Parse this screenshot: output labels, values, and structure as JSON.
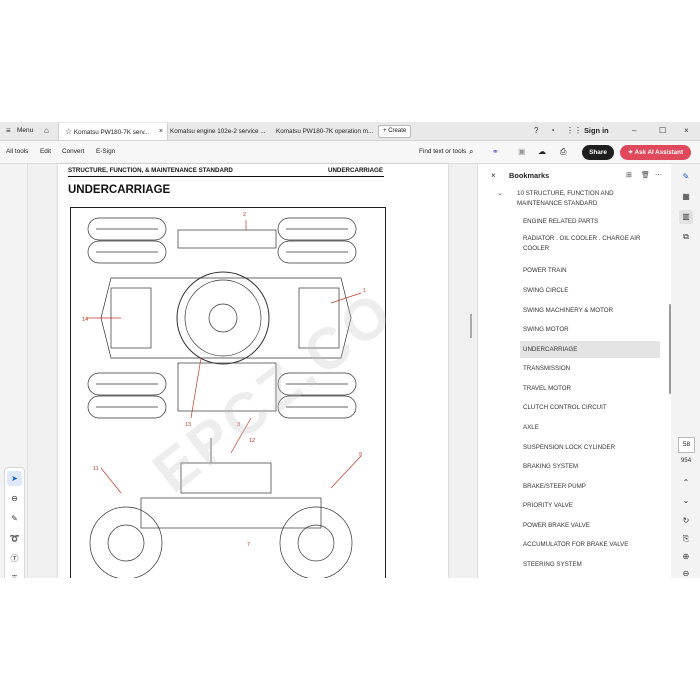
{
  "tabbar": {
    "menu_label": "Menu",
    "tabs": [
      {
        "label": "Komatsu PW180-7K serv..."
      },
      {
        "label": "Komatsu engine 102e-2 service ..."
      },
      {
        "label": "Komatsu PW180-7K operation m..."
      }
    ],
    "create_label": "Create",
    "signin_label": "Sign in",
    "close_glyph": "×"
  },
  "toolbar": {
    "all_tools": "All tools",
    "edit": "Edit",
    "convert": "Convert",
    "esign": "E-Sign",
    "find_placeholder": "Find text or tools",
    "share": "Share",
    "ai_assistant": "Ask AI Assistant"
  },
  "document": {
    "header_left": "STRUCTURE, FUNCTION, & MAINTENANCE STANDARD",
    "header_right": "UNDERCARRIAGE",
    "title": "UNDERCARRIAGE",
    "watermark": "EPCZ.CO",
    "callouts": [
      "2",
      "1",
      "14",
      "13",
      "3",
      "12",
      "11",
      "9",
      "7"
    ]
  },
  "bookmarks": {
    "title": "Bookmarks",
    "parent": "10 STRUCTURE, FUNCTION AND MAINTENANCE STANDARD",
    "items": [
      "ENGINE RELATED PARTS",
      "RADIATOR . OIL COOLER . CHARGE AIR COOLER",
      "POWER TRAIN",
      "SWING CIRCLE",
      "SWING MACHINERY & MOTOR",
      "SWING MOTOR",
      "UNDERCARRIAGE",
      "TRANSMISSION",
      "TRAVEL MOTOR",
      "CLUTCH CONTROL CIRCUIT",
      "AXLE",
      "SUSPENSION LOCK CYLINDER",
      "BRAKING SYSTEM",
      "BRAKE/STEER PUMP",
      "PRIORITY VALVE",
      "POWER BRAKE VALVE",
      "ACCUMULATOR FOR BRAKE VALVE",
      "STEERING SYSTEM"
    ],
    "selected": "UNDERCARRIAGE"
  },
  "pagination": {
    "current_page": "58",
    "total_pages": "954"
  },
  "colors": {
    "accent_ai": "#e0495c",
    "share_bg": "#1f1f1f",
    "selection_blue": "#1a5bd6"
  }
}
